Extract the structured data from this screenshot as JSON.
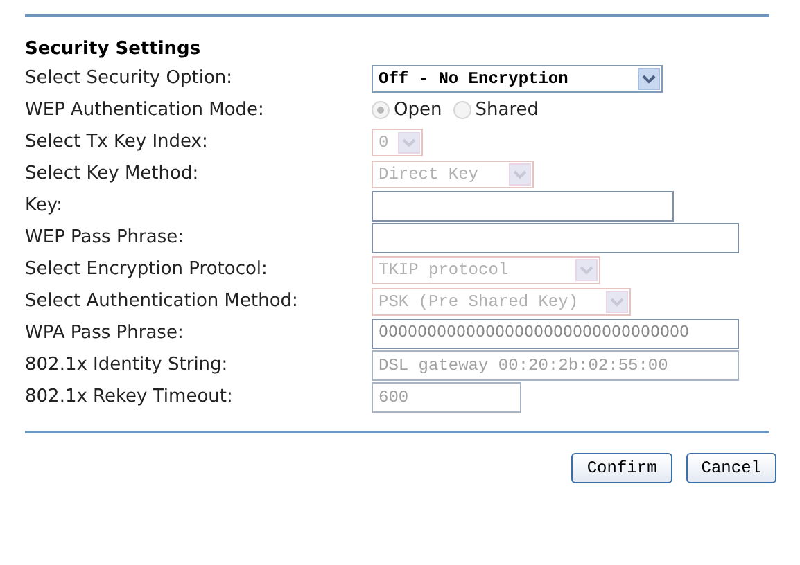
{
  "heading": "Security Settings",
  "rows": [
    {
      "label": "Select Security Option:",
      "kind": "select",
      "value": "Off - No Encryption",
      "disabled": false
    },
    {
      "label": "WEP Authentication Mode:",
      "kind": "radio",
      "disabled": true,
      "options": [
        {
          "label": "Open",
          "selected": true
        },
        {
          "label": "Shared",
          "selected": false
        }
      ]
    },
    {
      "label": "Select Tx Key Index:",
      "kind": "select",
      "value": "0",
      "disabled": true
    },
    {
      "label": "Select Key Method:",
      "kind": "select",
      "value": "Direct Key",
      "disabled": true
    },
    {
      "label": "Key:",
      "kind": "text",
      "disabled": false
    },
    {
      "label": "WEP Pass Phrase:",
      "kind": "text",
      "disabled": false
    },
    {
      "label": "Select Encryption Protocol:",
      "kind": "select",
      "value": "TKIP protocol",
      "disabled": true
    },
    {
      "label": "Select Authentication Method:",
      "kind": "select",
      "value": "PSK (Pre Shared Key)",
      "disabled": true
    },
    {
      "label": "WPA Pass Phrase:",
      "kind": "text",
      "value": "00000000000000000000000000000000",
      "disabled": false
    },
    {
      "label": "802.1x Identity String:",
      "kind": "text",
      "value": "DSL gateway 00:20:2b:02:55:00",
      "disabled": true
    },
    {
      "label": "802.1x Rekey Timeout:",
      "kind": "text",
      "value": "600",
      "disabled": true
    }
  ],
  "buttons": [
    "Confirm",
    "Cancel"
  ]
}
